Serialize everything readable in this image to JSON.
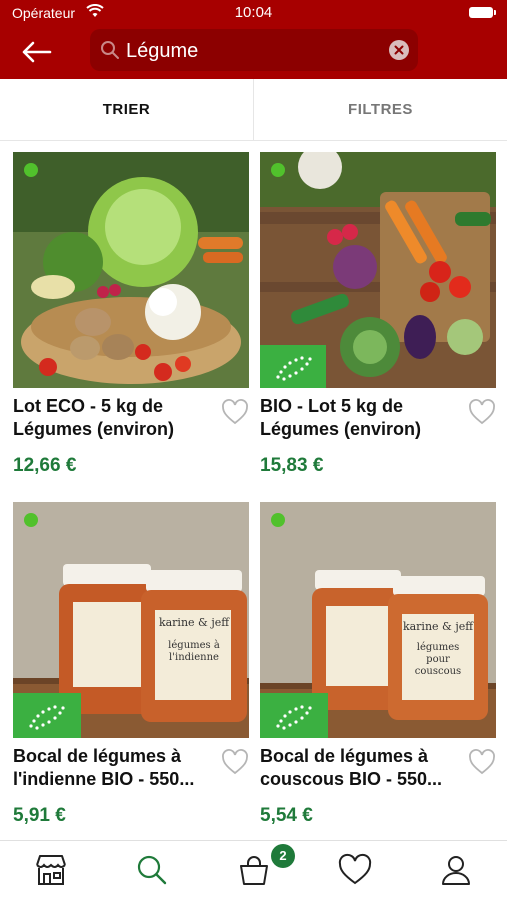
{
  "status_bar": {
    "carrier": "Opérateur",
    "time": "10:04"
  },
  "search": {
    "query": "Légume"
  },
  "tabs": [
    {
      "label": "TRIER"
    },
    {
      "label": "FILTRES"
    }
  ],
  "products": [
    {
      "title": "Lot ECO - 5 kg de Légumes (environ)",
      "price": "12,66 €",
      "organic_badge": false
    },
    {
      "title": "BIO - Lot 5 kg de Légumes (environ)",
      "price": "15,83 €",
      "organic_badge": true
    },
    {
      "title": "Bocal de légumes à l'indienne BIO - 550...",
      "price": "5,91 €",
      "organic_badge": true,
      "jar_brand": "karine & jeff",
      "jar_label": "légumes à l'indienne"
    },
    {
      "title": "Bocal de légumes à couscous BIO - 550...",
      "price": "5,54 €",
      "organic_badge": true,
      "jar_brand": "karine & jeff",
      "jar_label": "légumes pour couscous"
    }
  ],
  "bottom_nav": {
    "items": [
      "shop-icon",
      "search-icon",
      "cart-icon",
      "heart-icon",
      "user-icon"
    ],
    "cart_count": "2"
  },
  "colors": {
    "brand_red": "#a70000",
    "price_green": "#1f7a3a",
    "badge_green": "#3bb041"
  }
}
